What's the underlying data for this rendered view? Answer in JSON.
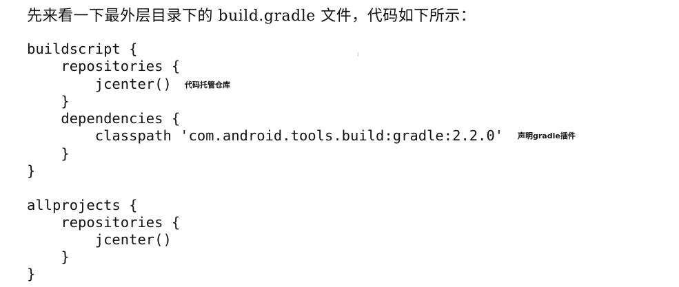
{
  "intro_text": "先来看一下最外层目录下的 build.gradle 文件，代码如下所示：",
  "code": {
    "lines": [
      "buildscript {",
      "    repositories {",
      "        jcenter()",
      "    }",
      "    dependencies {",
      "        classpath 'com.android.tools.build:gradle:2.2.0'",
      "    }",
      "}",
      "allprojects {",
      "    repositories {",
      "        jcenter()",
      "    }",
      "}"
    ],
    "annotations": {
      "jcenter": "代码托管仓库",
      "classpath": "声明gradle插件"
    }
  }
}
